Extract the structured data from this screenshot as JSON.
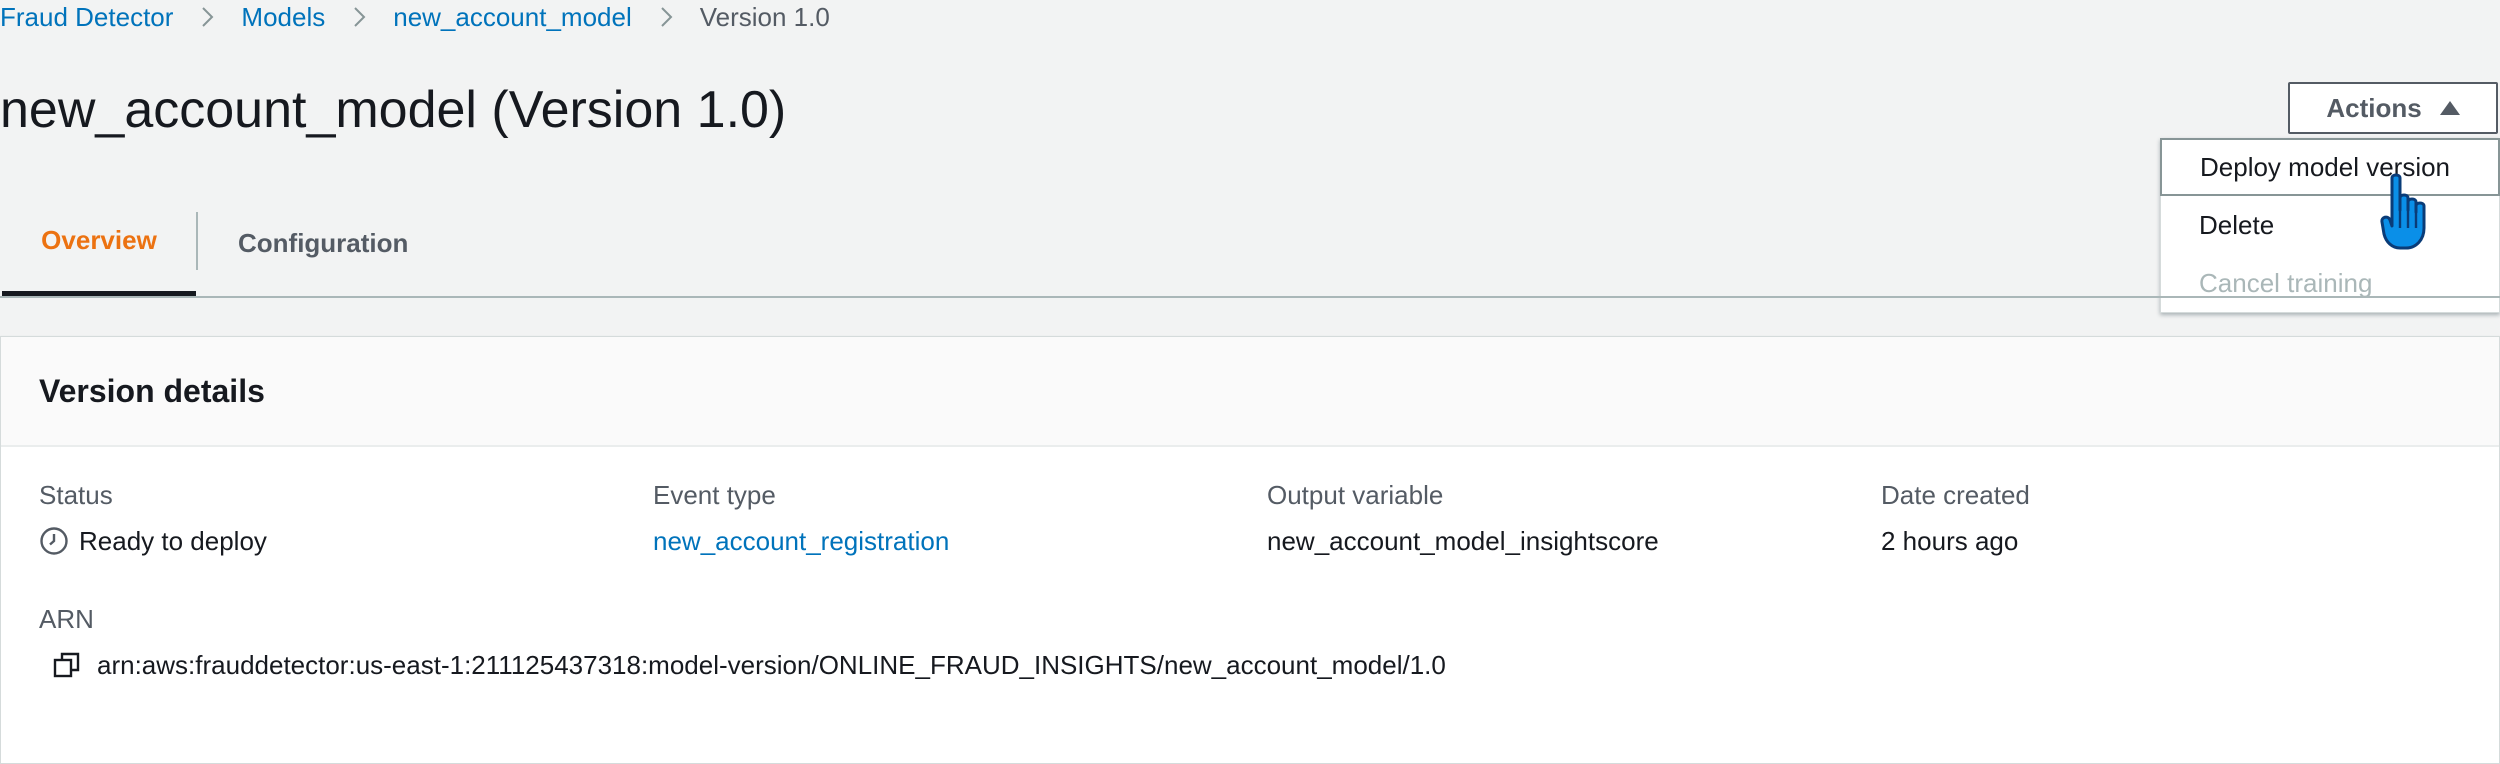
{
  "breadcrumb": {
    "items": [
      "Fraud Detector",
      "Models",
      "new_account_model"
    ],
    "current": "Version 1.0"
  },
  "page": {
    "title": "new_account_model (Version 1.0)"
  },
  "actions": {
    "label": "Actions",
    "menu": [
      "Deploy model version",
      "Delete",
      "Cancel training"
    ]
  },
  "tabs": [
    "Overview",
    "Configuration"
  ],
  "panel": {
    "title": "Version details",
    "status": {
      "label": "Status",
      "value": "Ready to deploy"
    },
    "event_type": {
      "label": "Event type",
      "value": "new_account_registration"
    },
    "output_variable": {
      "label": "Output variable",
      "value": "new_account_model_insightscore"
    },
    "date_created": {
      "label": "Date created",
      "value": "2 hours ago"
    },
    "arn": {
      "label": "ARN",
      "value": "arn:aws:frauddetector:us-east-1:211125437318:model-version/ONLINE_FRAUD_INSIGHTS/new_account_model/1.0"
    }
  },
  "colors": {
    "link": "#0073bb",
    "active_tab": "#ec7211",
    "background": "#f2f3f3",
    "cursor": "#0a8fe8"
  }
}
